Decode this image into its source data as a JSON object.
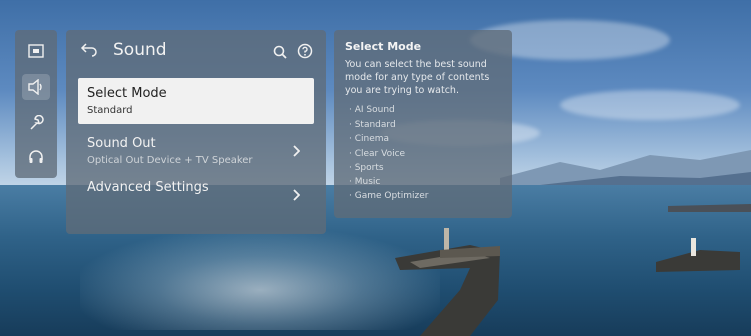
{
  "sidebar": {
    "icons": [
      {
        "name": "picture-icon",
        "active": false
      },
      {
        "name": "speaker-icon",
        "active": true
      },
      {
        "name": "wrench-icon",
        "active": false
      },
      {
        "name": "headset-icon",
        "active": false
      }
    ]
  },
  "menu": {
    "title": "Sound",
    "items": [
      {
        "label": "Select Mode",
        "sub": "Standard",
        "selected": true
      },
      {
        "label": "Sound Out",
        "sub": "Optical Out Device + TV Speaker",
        "selected": false
      },
      {
        "label": "Advanced Settings",
        "sub": "",
        "selected": false
      }
    ]
  },
  "info": {
    "title": "Select Mode",
    "description": "You can select the best sound mode for any type of contents you are trying to watch.",
    "options": [
      "· AI Sound",
      "· Standard",
      "· Cinema",
      "· Clear Voice",
      "· Sports",
      "· Music",
      "· Game Optimizer"
    ]
  }
}
